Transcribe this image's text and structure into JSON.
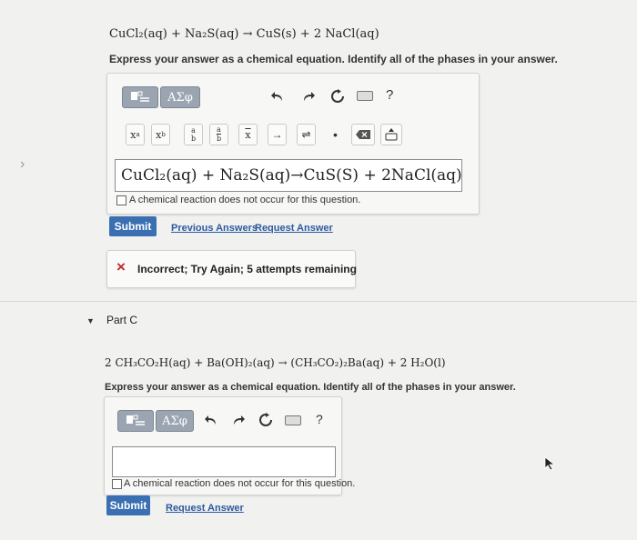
{
  "part_b": {
    "equation": "CuCl₂(aq) + Na₂S(aq) → CuS(s) + 2 NaCl(aq)",
    "instructions": "Express your answer as a chemical equation. Identify all of the phases in your answer.",
    "toolbar": {
      "greek_label": "ΑΣφ",
      "help_label": "?",
      "symbols": [
        "x",
        "a",
        "x",
        "b",
        "a",
        "b",
        "a",
        "b",
        "x",
        "→",
        "⇌",
        "•"
      ]
    },
    "answer": "CuCl₂(aq) + Na₂S(aq)→CuS(S) + 2NaCl(aq)",
    "no_reaction_label": "A chemical reaction does not occur for this question.",
    "submit_label": "Submit",
    "previous_answers_label": "Previous Answers",
    "request_answer_label": "Request Answer",
    "feedback": {
      "icon": "×",
      "text": "Incorrect; Try Again; 5 attempts remaining"
    }
  },
  "part_c": {
    "title": "Part C",
    "equation": "2 CH₃CO₂H(aq) + Ba(OH)₂(aq) → (CH₃CO₂)₂Ba(aq) + 2 H₂O(l)",
    "instructions": "Express your answer as a chemical equation. Identify all of the phases in your answer.",
    "toolbar": {
      "greek_label": "ΑΣφ",
      "help_label": "?"
    },
    "answer": "",
    "no_reaction_label": "A chemical reaction does not occur for this question.",
    "submit_label": "Submit",
    "request_answer_label": "Request Answer"
  },
  "colors": {
    "background": "#f1f1f0",
    "submit": "#3a6fb2",
    "link": "#2c5aa0",
    "incorrect": "#c0282d",
    "template_button": "#9aa5b1"
  }
}
